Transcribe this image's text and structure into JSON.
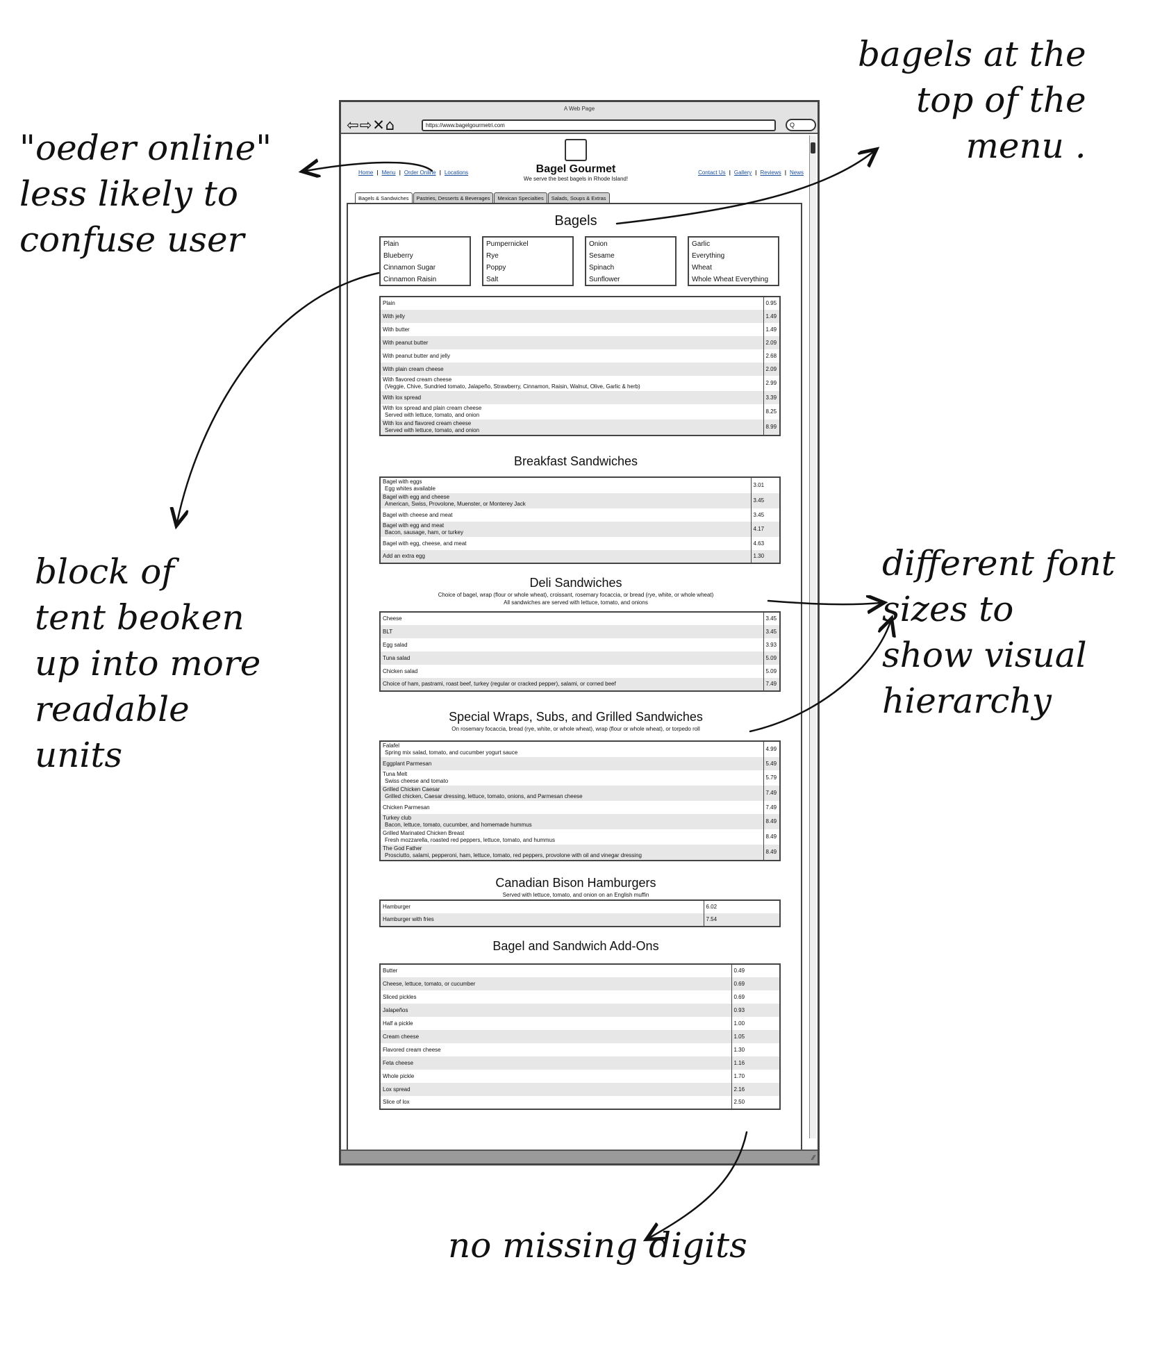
{
  "annotations": {
    "order_online": "\"oeder online\"\nless likely to\nconfuse user",
    "bagels_top": "bagels at the\ntop of the\nmenu .",
    "block": "block of\ntent beoken\nup into more\nreadable\nunits",
    "font_sizes": "different font\nsizes to\nshow visual\nhierarchy",
    "digits": "no missing digits"
  },
  "browser": {
    "title": "A Web Page",
    "nav_icons": "⇦⇨✕⌂",
    "url": "https://www.bagelgourmetri.com",
    "search": "Q"
  },
  "site": {
    "brand": "Bagel Gourmet",
    "tagline": "We serve the best bagels in Rhode Island!",
    "left_nav": [
      "Home",
      "Menu",
      "Order Online",
      "Locations"
    ],
    "right_nav": [
      "Contact Us",
      "Gallery",
      "Reviews",
      "News"
    ],
    "tabs": [
      "Bagels & Sandwiches",
      "Pastries, Desserts & Beverages",
      "Mexican Specialties",
      "Salads, Soups & Extras"
    ]
  },
  "bagels": {
    "title": "Bagels",
    "flavors": [
      [
        "Plain",
        "Blueberry",
        "Cinnamon Sugar",
        "Cinnamon Raisin"
      ],
      [
        "Pumpernickel",
        "Rye",
        "Poppy",
        "Salt"
      ],
      [
        "Onion",
        "Sesame",
        "Spinach",
        "Sunflower"
      ],
      [
        "Garlic",
        "Everything",
        "Wheat",
        "Whole Wheat Everything"
      ]
    ],
    "items": [
      {
        "name": "Plain",
        "price": "0.95"
      },
      {
        "name": "With jelly",
        "price": "1.49"
      },
      {
        "name": "With butter",
        "price": "1.49"
      },
      {
        "name": "With peanut butter",
        "price": "2.09"
      },
      {
        "name": "With peanut butter and jelly",
        "price": "2.68"
      },
      {
        "name": "With plain cream cheese",
        "price": "2.09"
      },
      {
        "name": "With flavored cream cheese",
        "desc": "(Veggie, Chive, Sundried tomato, Jalapeño, Strawberry, Cinnamon, Raisin, Walnut, Olive, Garlic & herb)",
        "price": "2.99"
      },
      {
        "name": "With lox spread",
        "price": "3.39"
      },
      {
        "name": "With lox spread and plain cream cheese",
        "desc": "Served with lettuce, tomato, and onion",
        "price": "8.25"
      },
      {
        "name": "With lox and flavored cream cheese",
        "desc": "Served with lettuce, tomato, and onion",
        "price": "8.99"
      }
    ]
  },
  "breakfast": {
    "title": "Breakfast Sandwiches",
    "items": [
      {
        "name": "Bagel with eggs",
        "desc": "Egg whites available",
        "price": "3.01"
      },
      {
        "name": "Bagel with egg and cheese",
        "desc": "American, Swiss, Provolone, Muenster, or Monterey Jack",
        "price": "3.45"
      },
      {
        "name": "Bagel with cheese and meat",
        "price": "3.45"
      },
      {
        "name": "Bagel with egg and meat",
        "desc": "Bacon, sausage, ham, or turkey",
        "price": "4.17"
      },
      {
        "name": "Bagel with egg, cheese, and meat",
        "price": "4.63"
      },
      {
        "name": "Add an extra egg",
        "price": "1.30"
      }
    ]
  },
  "deli": {
    "title": "Deli Sandwiches",
    "sub1": "Choice of bagel, wrap (flour or whole wheat), croissant, rosemary focaccia, or bread (rye, white, or whole wheat)",
    "sub2": "All sandwiches are served with lettuce, tomato, and onions",
    "items": [
      {
        "name": "Cheese",
        "price": "3.45"
      },
      {
        "name": "BLT",
        "price": "3.45"
      },
      {
        "name": "Egg salad",
        "price": "3.93"
      },
      {
        "name": "Tuna salad",
        "price": "5.09"
      },
      {
        "name": "Chicken salad",
        "price": "5.09"
      },
      {
        "name": "Choice of ham, pastrami, roast beef, turkey (regular or cracked pepper), salami, or corned beef",
        "price": "7.49"
      }
    ]
  },
  "wraps": {
    "title": "Special Wraps, Subs, and Grilled Sandwiches",
    "sub": "On rosemary focaccia, bread (rye, white, or whole wheat), wrap (flour or whole wheat), or torpedo roll",
    "items": [
      {
        "name": "Falafel",
        "desc": "Spring mix salad, tomato, and cucumber yogurt sauce",
        "price": "4.99"
      },
      {
        "name": "Eggplant Parmesan",
        "price": "5.49"
      },
      {
        "name": "Tuna Melt",
        "desc": "Swiss cheese and tomato",
        "price": "5.79"
      },
      {
        "name": "Grilled Chicken Caesar",
        "desc": "Grilled chicken, Caesar dressing, lettuce, tomato, onions, and Parmesan cheese",
        "price": "7.49"
      },
      {
        "name": "Chicken Parmesan",
        "price": "7.49"
      },
      {
        "name": "Turkey club",
        "desc": "Bacon, lettuce, tomato, cucumber, and homemade hummus",
        "price": "8.49"
      },
      {
        "name": "Grilled Marinated Chicken Breast",
        "desc": "Fresh mozzarella, roasted red peppers, lettuce, tomato, and hummus",
        "price": "8.49"
      },
      {
        "name": "The God Father",
        "desc": "Prosciutto, salami, pepperoni, ham, lettuce, tomato, red peppers, provolone with oil and vinegar dressing",
        "price": "8.49"
      }
    ]
  },
  "bison": {
    "title": "Canadian Bison Hamburgers",
    "sub": "Served with lettuce, tomato, and onion on an English muffin",
    "items": [
      {
        "name": "Hamburger",
        "price": "6.02"
      },
      {
        "name": "Hamburger with fries",
        "price": "7.54"
      }
    ]
  },
  "addons": {
    "title": "Bagel and Sandwich Add-Ons",
    "items": [
      {
        "name": "Butter",
        "price": "0.49"
      },
      {
        "name": "Cheese, lettuce, tomato, or cucumber",
        "price": "0.69"
      },
      {
        "name": "Sliced pickles",
        "price": "0.69"
      },
      {
        "name": "Jalapeños",
        "price": "0.93"
      },
      {
        "name": "Half a pickle",
        "price": "1.00"
      },
      {
        "name": "Cream cheese",
        "price": "1.05"
      },
      {
        "name": "Flavored cream cheese",
        "price": "1.30"
      },
      {
        "name": "Feta cheese",
        "price": "1.16"
      },
      {
        "name": "Whole pickle",
        "price": "1.70"
      },
      {
        "name": "Lox spread",
        "price": "2.16"
      },
      {
        "name": "Slice of lox",
        "price": "2.50"
      }
    ]
  }
}
